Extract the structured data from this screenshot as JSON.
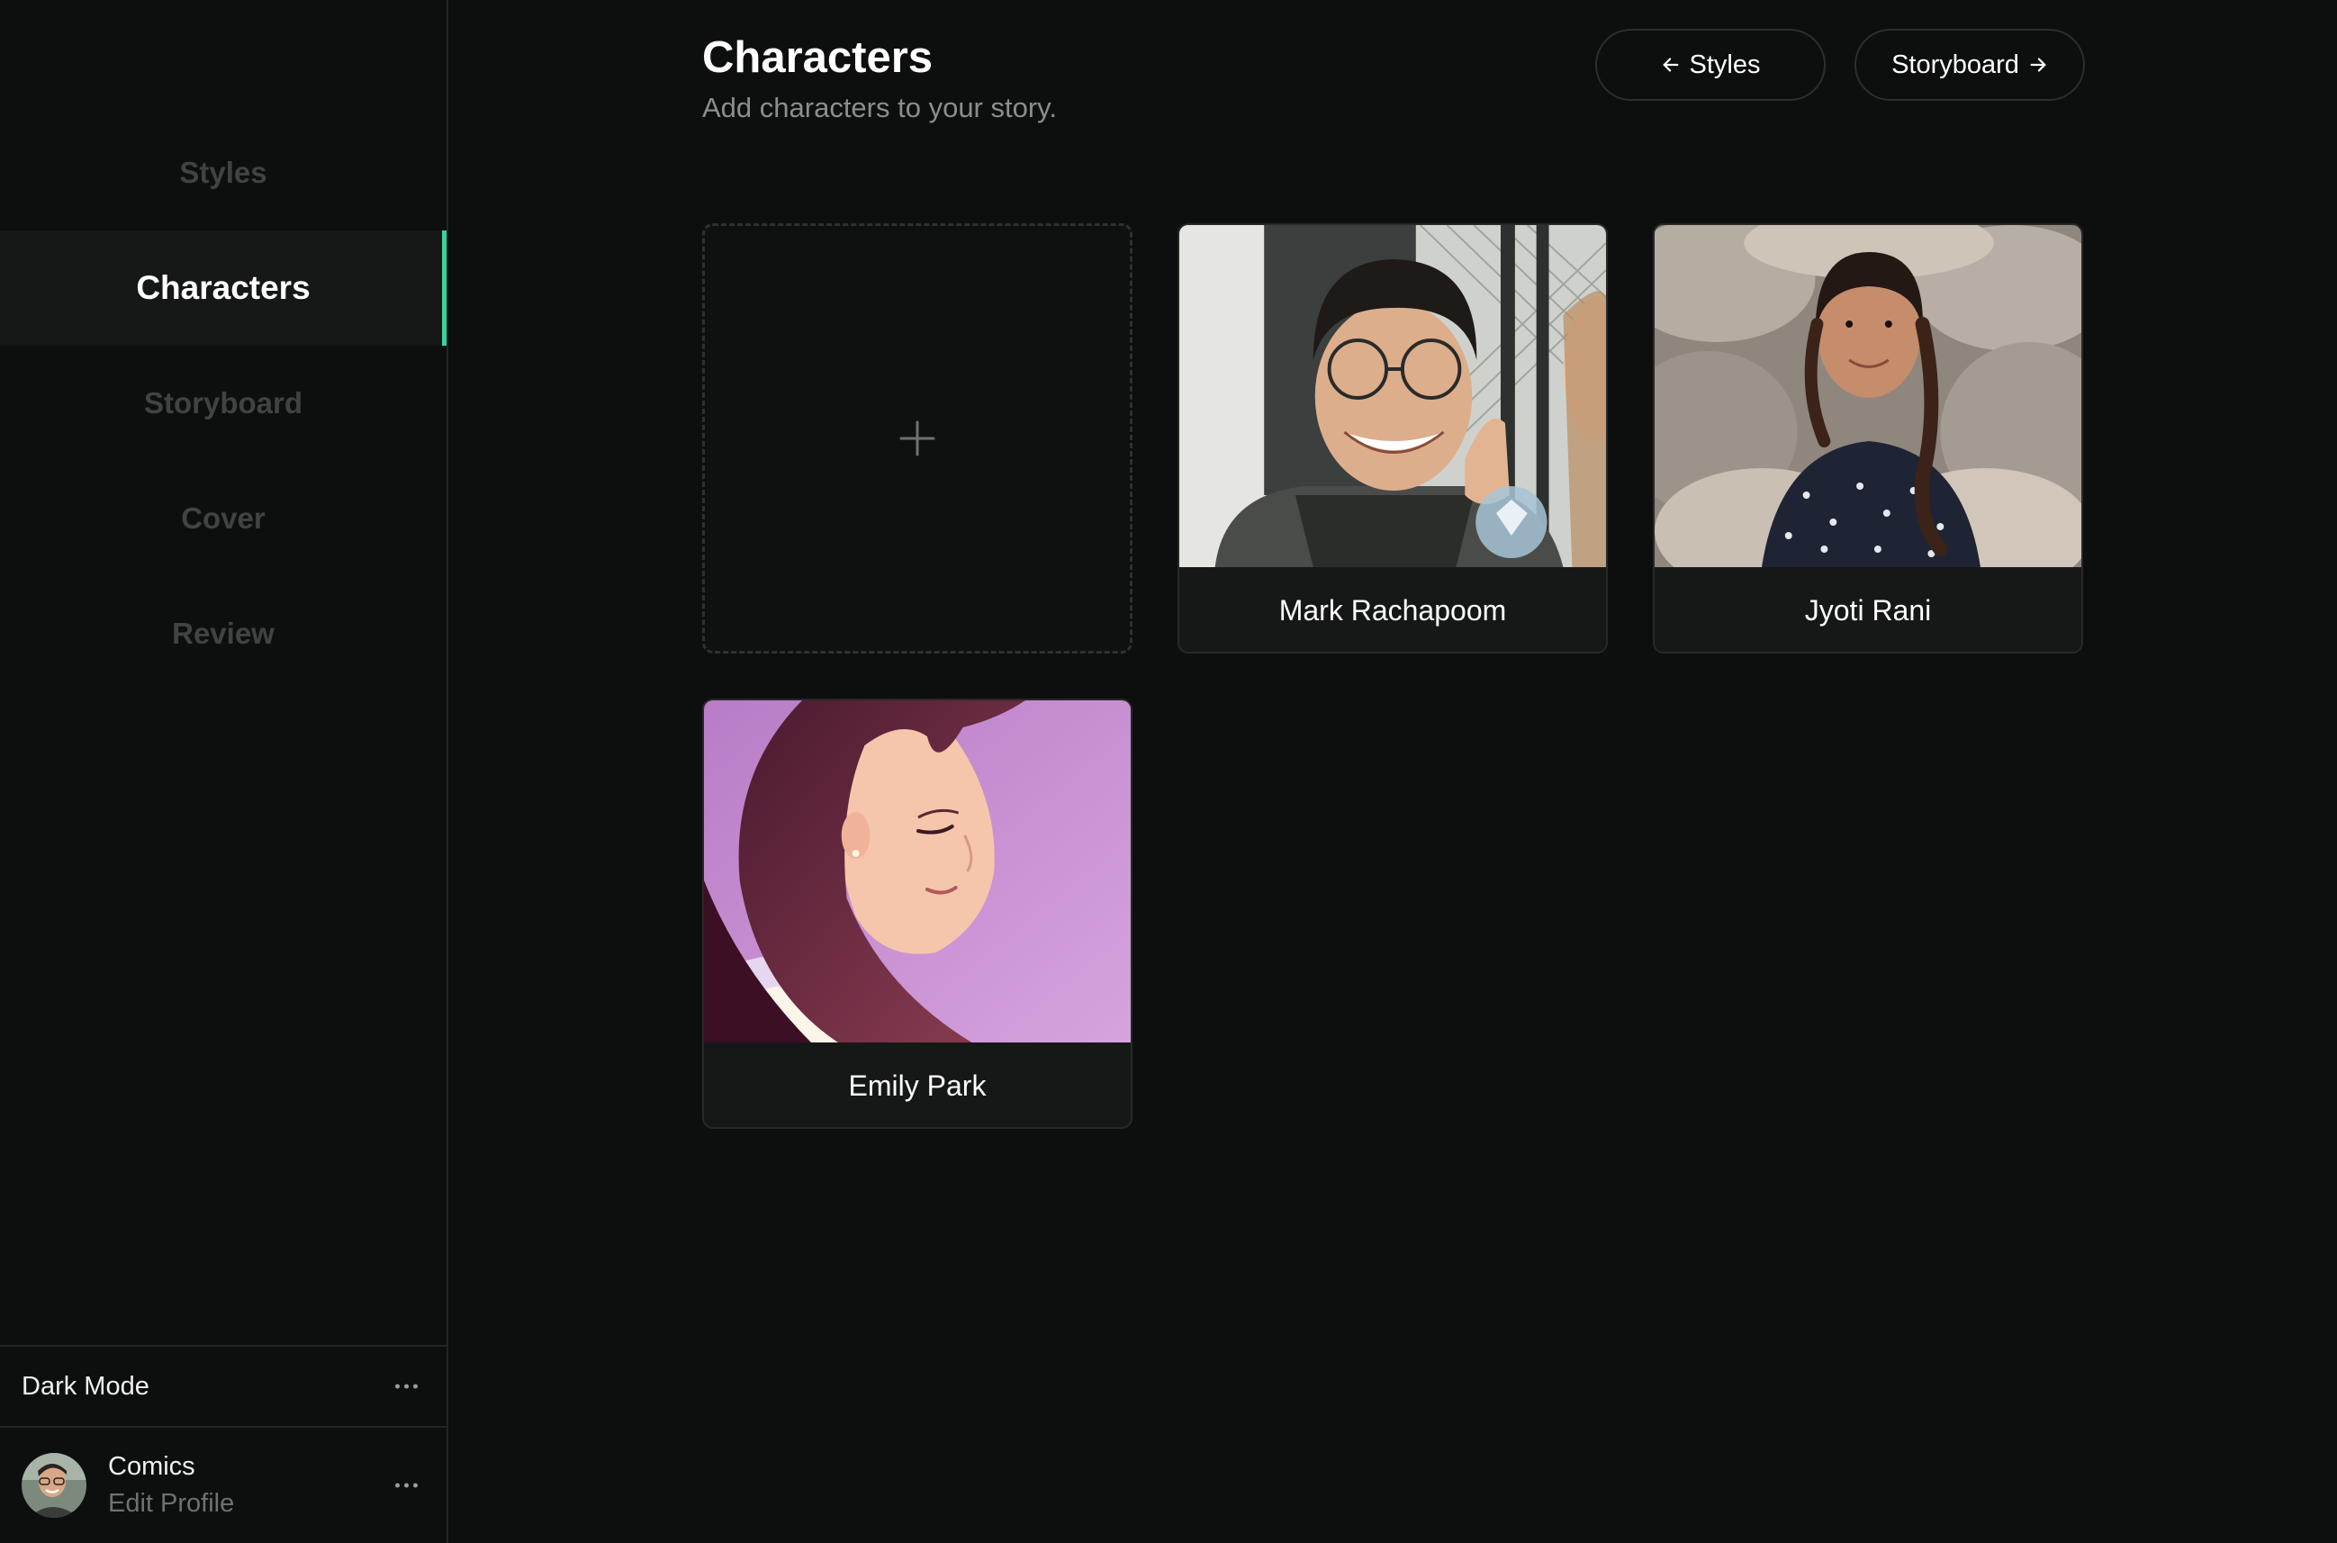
{
  "sidebar": {
    "nav": [
      {
        "label": "Styles",
        "active": false
      },
      {
        "label": "Characters",
        "active": true
      },
      {
        "label": "Storyboard",
        "active": false
      },
      {
        "label": "Cover",
        "active": false
      },
      {
        "label": "Review",
        "active": false
      }
    ],
    "dark_mode_label": "Dark Mode",
    "profile": {
      "name": "Comics",
      "sub": "Edit Profile"
    }
  },
  "header": {
    "title": "Characters",
    "subtitle": "Add characters to your story.",
    "back_button": "Styles",
    "next_button": "Storyboard"
  },
  "add_card": {
    "icon": "plus-icon"
  },
  "characters": [
    {
      "name": "Mark Rachapoom"
    },
    {
      "name": "Jyoti Rani"
    },
    {
      "name": "Emily Park"
    }
  ],
  "colors": {
    "background": "#0d0f0e",
    "accent": "#3dd39a",
    "muted_nav": "#3f4341"
  }
}
